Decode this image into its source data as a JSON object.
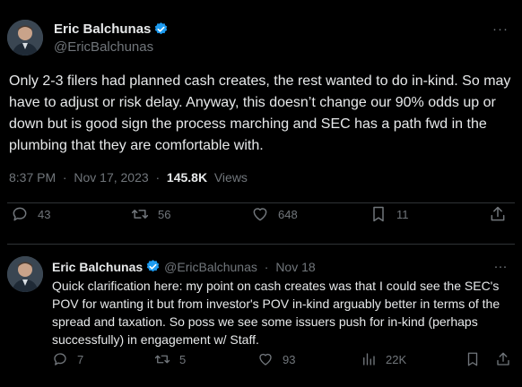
{
  "main_tweet": {
    "author_name": "Eric Balchunas",
    "author_handle": "@EricBalchunas",
    "more_label": "···",
    "text": "Only 2-3 filers had planned cash creates, the rest wanted to do in-kind. So may have to adjust or risk delay. Anyway, this doesn’t change our 90% odds up or down but is good sign the process marching and SEC has a path fwd in the plumbing that they are comfortable with.",
    "time": "8:37 PM",
    "separator": "·",
    "date": "Nov 17, 2023",
    "views_count": "145.8K",
    "views_label": "Views",
    "replies": "43",
    "retweets": "56",
    "likes": "648",
    "bookmarks": "11"
  },
  "reply_tweet": {
    "author_name": "Eric Balchunas",
    "author_handle": "@EricBalchunas",
    "separator": "·",
    "date": "Nov 18",
    "more_label": "···",
    "text": "Quick clarification here: my point on cash creates was that I could see the SEC's POV for wanting it but from investor's POV in-kind arguably better in terms of the spread and taxation. So poss we see some issuers push for in-kind (perhaps successfully) in engagement w/ Staff.",
    "replies": "7",
    "retweets": "5",
    "likes": "93",
    "views": "22K"
  },
  "colors": {
    "background": "#000000",
    "text_primary": "#e7e9ea",
    "text_secondary": "#71767b",
    "verified_badge": "#1d9bf0",
    "divider": "#2f3336"
  },
  "icons": [
    "verified-badge-icon",
    "reply-icon",
    "retweet-icon",
    "like-icon",
    "bookmark-icon",
    "views-icon",
    "share-icon"
  ]
}
